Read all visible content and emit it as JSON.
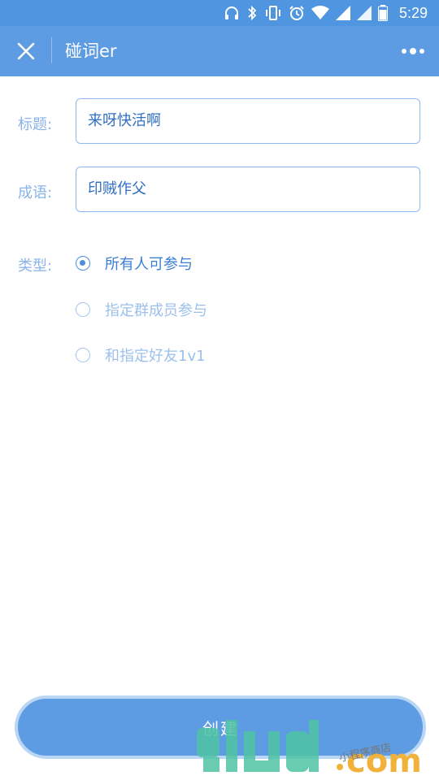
{
  "status_bar": {
    "time": "5:29",
    "icons": [
      "headphones-icon",
      "bluetooth-icon",
      "vibrate-icon",
      "alarm-icon",
      "wifi-icon",
      "signal-icon",
      "signal-icon-2",
      "battery-icon"
    ]
  },
  "nav": {
    "title": "碰词er",
    "close_icon": "close-icon",
    "more_icon": "more-icon"
  },
  "form": {
    "title_label": "标题:",
    "title_value": "来呀快活啊",
    "idiom_label": "成语:",
    "idiom_value": "印贼作父",
    "type_label": "类型:",
    "type_options": [
      {
        "label": "所有人可参与",
        "checked": true
      },
      {
        "label": "指定群成员参与",
        "checked": false
      },
      {
        "label": "和指定好友1v1",
        "checked": false
      }
    ]
  },
  "create_button": {
    "label": "创建"
  },
  "watermark": {
    "text": "小程序商店"
  },
  "colors": {
    "nav_bg": "#5d9be3",
    "status_bg": "#4f95df",
    "accent": "#4a8edc",
    "label": "#8ab4e8"
  }
}
